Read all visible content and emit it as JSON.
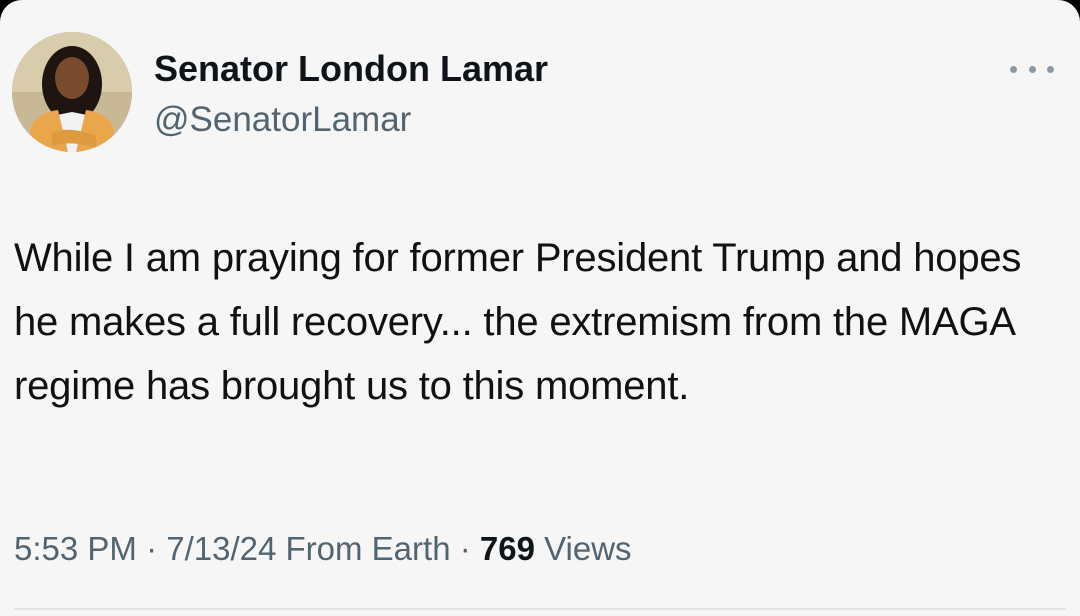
{
  "tweet": {
    "author": {
      "display_name": "Senator London Lamar",
      "handle": "@SenatorLamar",
      "avatar_icon": "profile-photo"
    },
    "more_icon": "more-options-icon",
    "text": "While I am praying for former President Trump and hopes he makes a full recovery... the extremism from the MAGA regime has brought us to this moment.",
    "meta": {
      "time": "5:53 PM",
      "separator": " · ",
      "date": "7/13/24",
      "source": "From Earth",
      "views_count": "769",
      "views_label": "Views"
    }
  }
}
